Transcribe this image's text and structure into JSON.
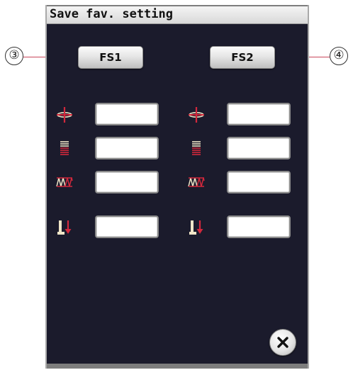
{
  "window": {
    "title": "Save fav. setting"
  },
  "callouts": {
    "left": "③",
    "right": "④"
  },
  "buttons": {
    "fs1_label": "FS1",
    "fs2_label": "FS2",
    "close_icon": "x-icon"
  },
  "setting_rows": [
    {
      "icon": "thread-tension-icon",
      "fs1_value": "",
      "fs2_value": ""
    },
    {
      "icon": "stitch-length-icon",
      "fs1_value": "",
      "fs2_value": ""
    },
    {
      "icon": "stitch-width-icon",
      "fs1_value": "",
      "fs2_value": ""
    },
    {
      "icon": "presser-foot-pressure-icon",
      "fs1_value": "",
      "fs2_value": ""
    }
  ],
  "colors": {
    "screen_background": "#1b1b2c",
    "icon_red": "#d2283c",
    "icon_cream": "#f0e6c8",
    "callout_line": "#c9465a"
  }
}
